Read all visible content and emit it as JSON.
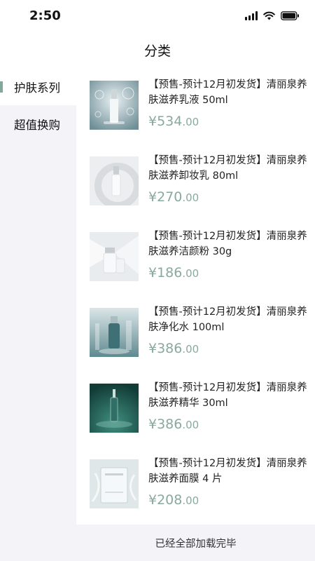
{
  "status": {
    "time": "2:50"
  },
  "nav": {
    "title": "分类"
  },
  "sidebar": {
    "items": [
      {
        "label": "护肤系列",
        "active": true
      },
      {
        "label": "超值换购",
        "active": false
      }
    ]
  },
  "products": [
    {
      "title": "【预售-预计12月初发货】清丽泉养肤滋养乳液 50ml",
      "currency": "¥",
      "price_int": "534",
      "price_dec": ".00"
    },
    {
      "title": "【预售-预计12月初发货】清丽泉养肤滋养卸妆乳 80ml",
      "currency": "¥",
      "price_int": "270",
      "price_dec": ".00"
    },
    {
      "title": "【预售-预计12月初发货】清丽泉养肤滋养洁颜粉 30g",
      "currency": "¥",
      "price_int": "186",
      "price_dec": ".00"
    },
    {
      "title": "【预售-预计12月初发货】清丽泉养肤净化水 100ml",
      "currency": "¥",
      "price_int": "386",
      "price_dec": ".00"
    },
    {
      "title": "【预售-预计12月初发货】清丽泉养肤滋养精华 30ml",
      "currency": "¥",
      "price_int": "386",
      "price_dec": ".00"
    },
    {
      "title": "【预售-预计12月初发货】清丽泉养肤滋养面膜 4 片",
      "currency": "¥",
      "price_int": "208",
      "price_dec": ".00"
    }
  ],
  "footer": {
    "text": "已经全部加载完毕"
  },
  "colors": {
    "accent": "#8aa99d",
    "sidebar_bg": "#f4f3f8"
  }
}
